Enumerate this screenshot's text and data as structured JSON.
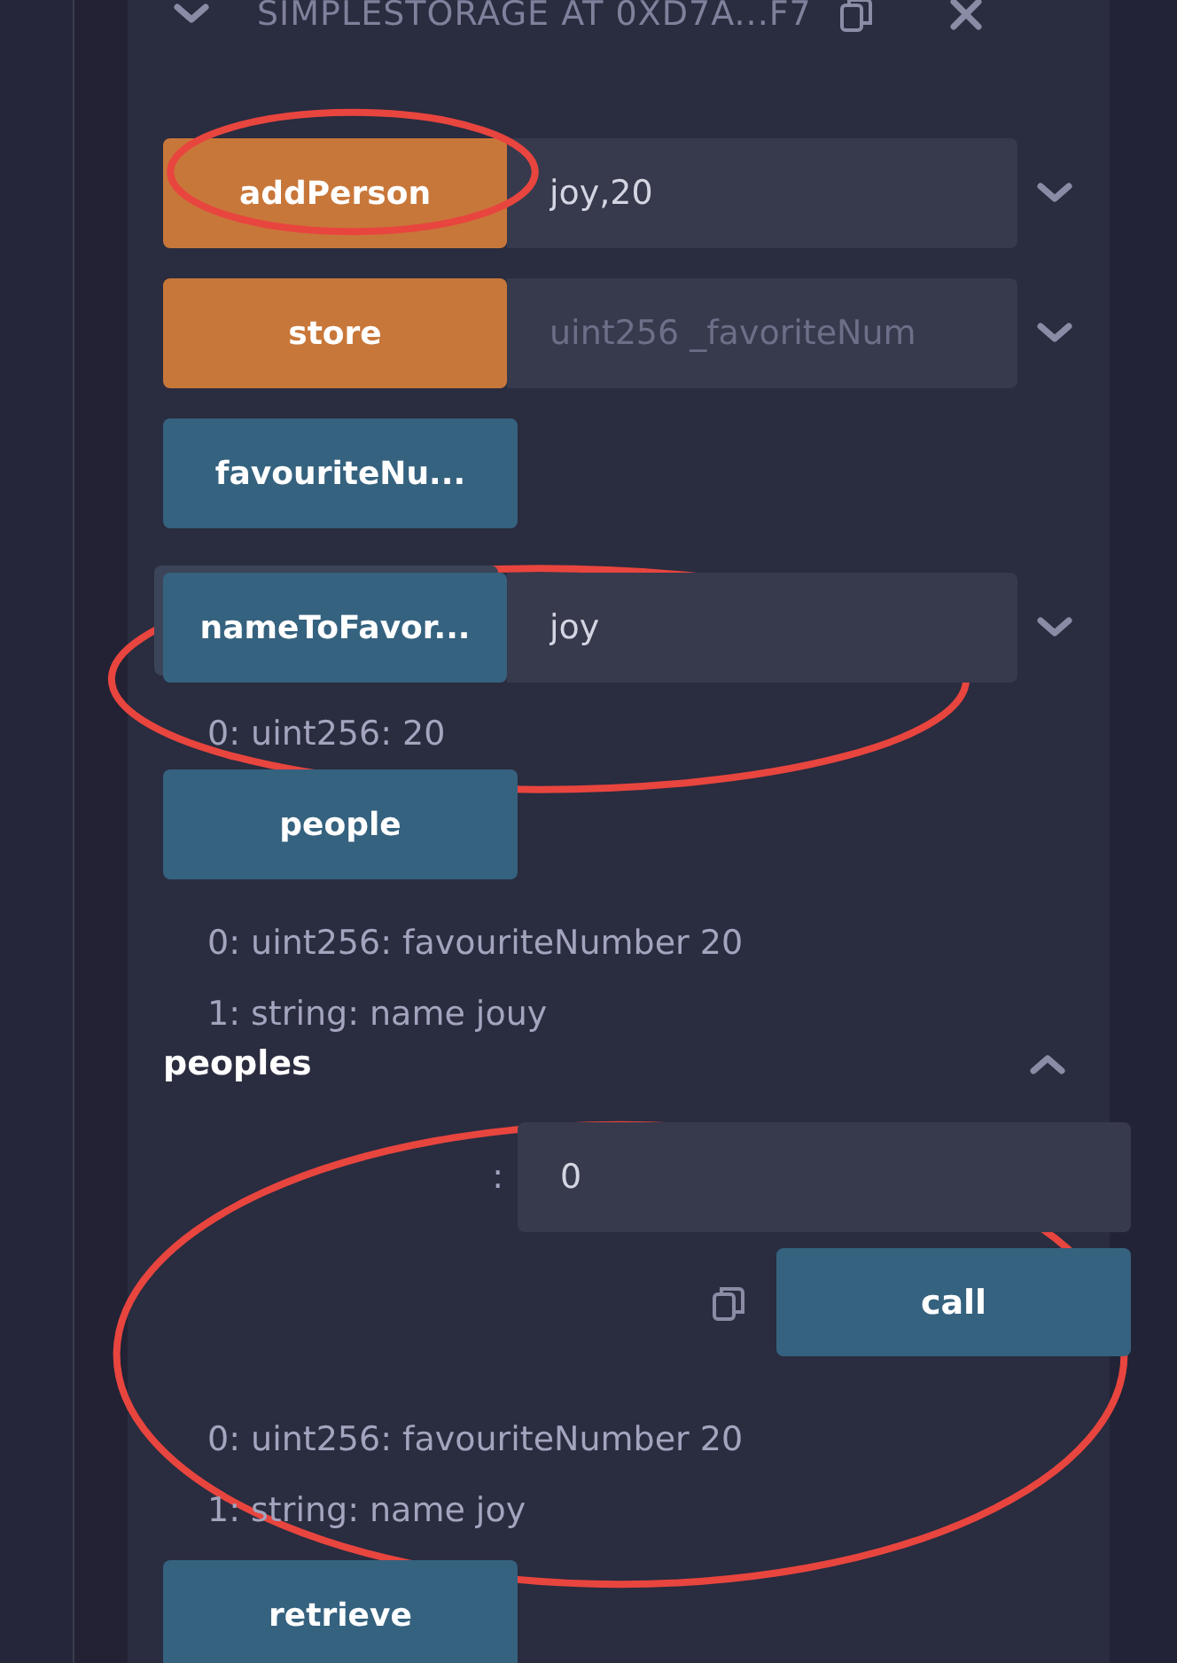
{
  "contract": {
    "title": "SIMPLESTORAGE AT 0XD7A...F7"
  },
  "functions": [
    {
      "kind": "transact",
      "label": "addPerson",
      "value": "joy,20",
      "expanded": false,
      "circled": true
    },
    {
      "kind": "transact",
      "label": "store",
      "placeholder": "uint256 _favoriteNum",
      "expanded": false
    },
    {
      "kind": "call",
      "label": "favouriteNu..."
    },
    {
      "kind": "call",
      "label": "nameToFavor...",
      "value": "joy",
      "expanded": false,
      "outputs": [
        "0: uint256: 20"
      ],
      "circled": true
    },
    {
      "kind": "call",
      "label": "people",
      "outputs": [
        "0: uint256: favouriteNumber 20",
        "1: string: name jouy"
      ]
    },
    {
      "kind": "open",
      "label": "peoples",
      "expanded": true,
      "param_label": ":",
      "param_value": "0",
      "action": "call",
      "outputs": [
        "0: uint256: favouriteNumber 20",
        "1: string: name joy"
      ],
      "circled": true
    },
    {
      "kind": "call",
      "label": "retrieve"
    }
  ]
}
